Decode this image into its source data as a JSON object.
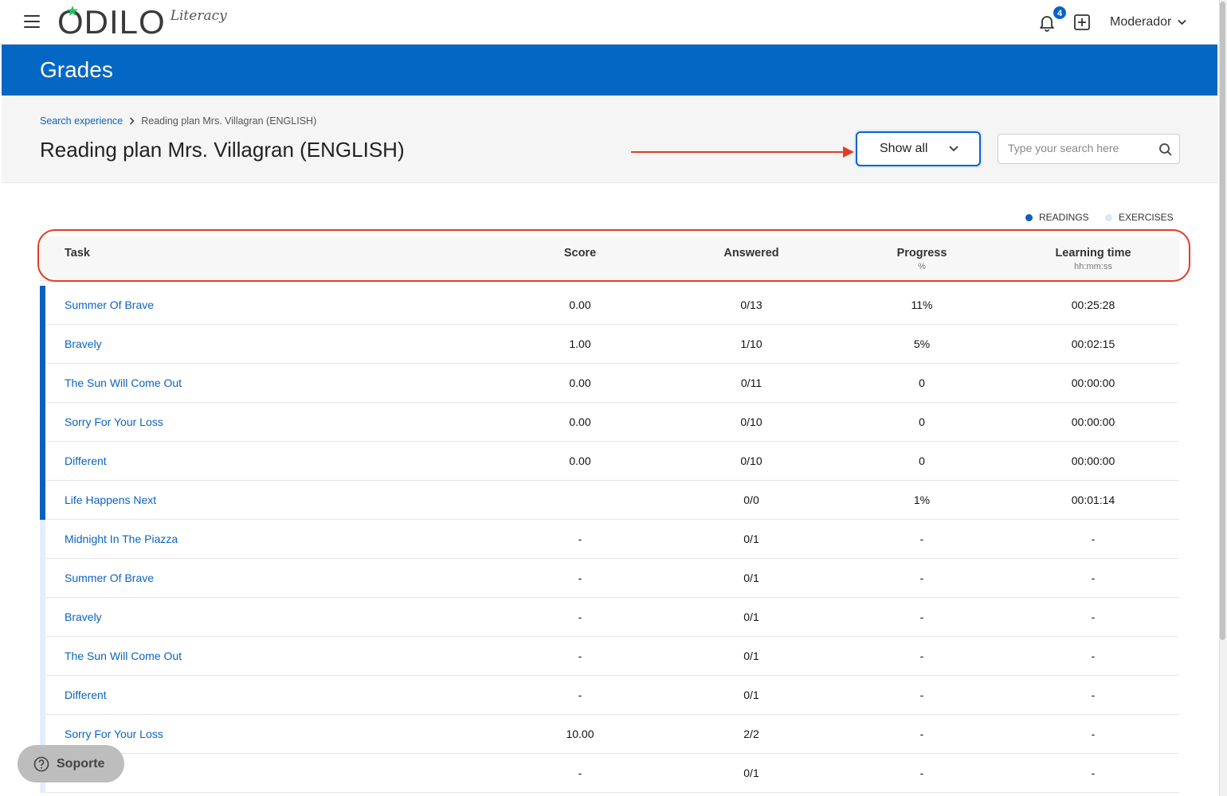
{
  "brand": {
    "name": "ODILO",
    "product": "Literacy"
  },
  "header": {
    "notifications_count": "4",
    "user_label": "Moderador"
  },
  "page": {
    "section_title": "Grades",
    "title": "Reading plan Mrs. Villagran (ENGLISH)"
  },
  "breadcrumb": {
    "parent": "Search experience",
    "current": "Reading plan Mrs. Villagran (ENGLISH)"
  },
  "filter": {
    "selected": "Show all"
  },
  "search": {
    "placeholder": "Type your search here"
  },
  "legend": {
    "readings": "READINGS",
    "exercises": "EXERCISES"
  },
  "colors": {
    "reading_bar": "#0a5fbf",
    "exercise_bar": "#e3eefb",
    "accent": "#0567c4",
    "annotation": "#e33c24"
  },
  "columns": {
    "task": "Task",
    "score": "Score",
    "answered": "Answered",
    "progress": "Progress",
    "progress_unit": "%",
    "time": "Learning time",
    "time_unit": "hh:mm:ss"
  },
  "rows": [
    {
      "type": "reading",
      "task": "Summer Of Brave",
      "score": "0.00",
      "answered": "0/13",
      "progress": "11%",
      "time": "00:25:28"
    },
    {
      "type": "reading",
      "task": "Bravely",
      "score": "1.00",
      "answered": "1/10",
      "progress": "5%",
      "time": "00:02:15"
    },
    {
      "type": "reading",
      "task": "The Sun Will Come Out",
      "score": "0.00",
      "answered": "0/11",
      "progress": "0",
      "time": "00:00:00"
    },
    {
      "type": "reading",
      "task": "Sorry For Your Loss",
      "score": "0.00",
      "answered": "0/10",
      "progress": "0",
      "time": "00:00:00"
    },
    {
      "type": "reading",
      "task": "Different",
      "score": "0.00",
      "answered": "0/10",
      "progress": "0",
      "time": "00:00:00"
    },
    {
      "type": "reading",
      "task": "Life Happens Next",
      "score": "",
      "answered": "0/0",
      "progress": "1%",
      "time": "00:01:14"
    },
    {
      "type": "exercise",
      "task": "Midnight In The Piazza",
      "score": "-",
      "answered": "0/1",
      "progress": "-",
      "time": "-"
    },
    {
      "type": "exercise",
      "task": "Summer Of Brave",
      "score": "-",
      "answered": "0/1",
      "progress": "-",
      "time": "-"
    },
    {
      "type": "exercise",
      "task": "Bravely",
      "score": "-",
      "answered": "0/1",
      "progress": "-",
      "time": "-"
    },
    {
      "type": "exercise",
      "task": "The Sun Will Come Out",
      "score": "-",
      "answered": "0/1",
      "progress": "-",
      "time": "-"
    },
    {
      "type": "exercise",
      "task": "Different",
      "score": "-",
      "answered": "0/1",
      "progress": "-",
      "time": "-"
    },
    {
      "type": "exercise",
      "task": "Sorry For Your Loss",
      "score": "10.00",
      "answered": "2/2",
      "progress": "-",
      "time": "-"
    },
    {
      "type": "exercise",
      "task": "",
      "score": "-",
      "answered": "0/1",
      "progress": "-",
      "time": "-"
    }
  ],
  "support": {
    "label": "Soporte"
  }
}
